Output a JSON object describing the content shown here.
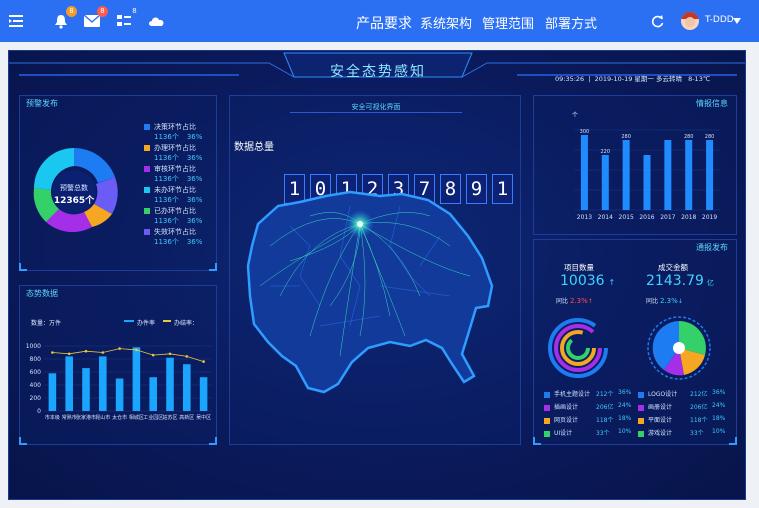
{
  "topbar": {
    "nav": [
      "产品要求",
      "系统架构",
      "管理范围",
      "部署方式"
    ],
    "bell_badge": "8",
    "mail_badge": "8",
    "msg_badge": "8",
    "username": "T-DDD",
    "colors": {
      "bar": "#2b6ff2"
    }
  },
  "header": {
    "title": "安全态势感知",
    "time": "09:35:26",
    "date": "2019-10-19",
    "weekday": "星期一",
    "weather": "多云转晴",
    "temp": "8-13℃"
  },
  "alerts": {
    "title": "预警发布",
    "center_label": "预警总数",
    "center_value": "12365个",
    "items": [
      {
        "label": "决策环节占比",
        "count": "1136个",
        "pct": "36%",
        "color": "#1e7cf2"
      },
      {
        "label": "办理环节占比",
        "count": "1136个",
        "pct": "36%",
        "color": "#f5a623"
      },
      {
        "label": "审核环节占比",
        "count": "1136个",
        "pct": "36%",
        "color": "#a52ee8"
      },
      {
        "label": "未办环节占比",
        "count": "1136个",
        "pct": "36%",
        "color": "#19c7f0"
      },
      {
        "label": "已办环节占比",
        "count": "1136个",
        "pct": "36%",
        "color": "#34d16b"
      },
      {
        "label": "失效环节占比",
        "count": "1136个",
        "pct": "36%",
        "color": "#6b5cf5"
      }
    ]
  },
  "trend": {
    "title": "态势数据",
    "unit_label": "数量：万件",
    "legend1": "办件率",
    "legend2": "办结率：",
    "chart_data": {
      "type": "bar",
      "categories": [
        "市本级",
        "常熟市",
        "张家港市",
        "昆山市",
        "太仓市",
        "相城区",
        "工业园区",
        "姑苏区",
        "高新区",
        "吴中区"
      ],
      "values": [
        580,
        840,
        660,
        840,
        500,
        980,
        520,
        820,
        720,
        520
      ],
      "line": [
        900,
        880,
        920,
        900,
        960,
        940,
        860,
        880,
        840,
        760
      ],
      "ylim": [
        0,
        1000
      ],
      "yticks": [
        0,
        200,
        400,
        600,
        800,
        1000
      ]
    }
  },
  "center": {
    "subtitle": "安全可视化界面",
    "total_label": "数据总量",
    "digits": [
      "1",
      "0",
      "1",
      "2",
      "3",
      "7",
      "8",
      "9",
      "1"
    ]
  },
  "intel": {
    "title": "情报信息",
    "unit": "个",
    "chart_data": {
      "type": "bar",
      "categories": [
        "2013",
        "2014",
        "2015",
        "2016",
        "2017",
        "2018",
        "2019"
      ],
      "values": [
        300,
        220,
        280,
        220,
        280,
        280,
        280
      ],
      "labels": [
        "300",
        "220",
        "280",
        "",
        "",
        "280",
        "280"
      ],
      "ylim": [
        0,
        320
      ]
    }
  },
  "bulletin": {
    "title": "通报发布",
    "proj_label": "项目数量",
    "proj_value": "10036",
    "proj_arrow": "↑",
    "proj_yoy_label": "同比",
    "proj_yoy": "2.3%",
    "proj_yoy_arrow": "↑",
    "amount_label": "成交金额",
    "amount_value": "2143.79",
    "amount_unit": "亿",
    "amount_yoy_label": "同比",
    "amount_yoy": "2.3%",
    "amount_yoy_arrow": "↓",
    "items_left": [
      {
        "label": "手机主题设计",
        "count": "212个",
        "pct": "36%",
        "color": "#1e7cf2"
      },
      {
        "label": "插画设计",
        "count": "206亿",
        "pct": "24%",
        "color": "#a52ee8"
      },
      {
        "label": "网页设计",
        "count": "118个",
        "pct": "18%",
        "color": "#f5a623"
      },
      {
        "label": "UI设计",
        "count": "33个",
        "pct": "10%",
        "color": "#34d16b"
      }
    ],
    "items_right": [
      {
        "label": "LOGO设计",
        "count": "212亿",
        "pct": "36%",
        "color": "#1e7cf2"
      },
      {
        "label": "画册设计",
        "count": "206亿",
        "pct": "24%",
        "color": "#a52ee8"
      },
      {
        "label": "平面设计",
        "count": "118个",
        "pct": "18%",
        "color": "#f5a623"
      },
      {
        "label": "游戏设计",
        "count": "33个",
        "pct": "10%",
        "color": "#34d16b"
      }
    ]
  }
}
